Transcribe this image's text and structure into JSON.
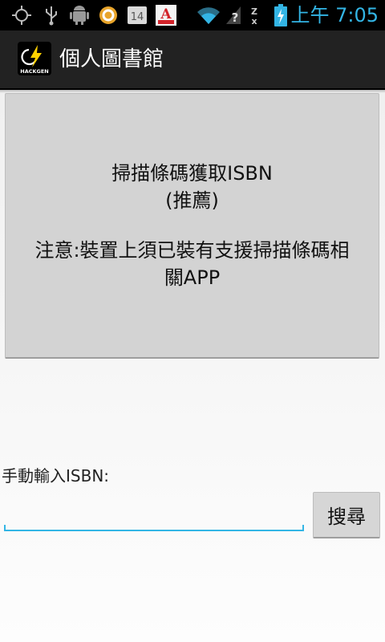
{
  "status_bar": {
    "time": "上午 7:05",
    "icons": [
      "gps-icon",
      "usb-icon",
      "android-debug-icon",
      "sync-app-icon",
      "calendar-icon",
      "font-app-icon",
      "wifi-icon",
      "no-signal-icon",
      "data-icon",
      "battery-charging-icon"
    ],
    "calendar_day": "14",
    "accent_color": "#33b5e5"
  },
  "action_bar": {
    "title": "個人圖書館",
    "app_icon_text": "HACKGEN"
  },
  "scan_button": {
    "line1": "掃描條碼獲取ISBN",
    "line2": "(推薦)",
    "note_line1": "注意:裝置上須已裝有支援掃描條碼相",
    "note_line2": "關APP"
  },
  "manual": {
    "label": "手動輸入ISBN:",
    "input_value": "",
    "search_label": "搜尋"
  }
}
